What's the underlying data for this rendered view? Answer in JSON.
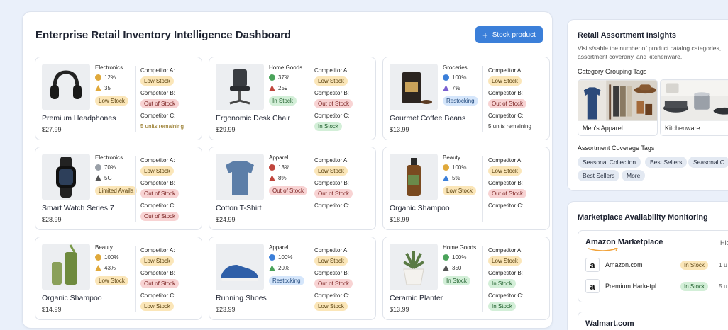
{
  "dashboard": {
    "title": "Enterprise Retail Inventory Intelligence Dashboard",
    "stock_button": "Stock product"
  },
  "products": [
    {
      "category": "Electronics",
      "stat1": "12%",
      "stat2": "35",
      "own_status": "Low Stock",
      "name": "Premium Headphones",
      "price": "$27.99",
      "comp_a": "Low Stock",
      "comp_b": "Out of Stock",
      "comp_c": "5 units remaining"
    },
    {
      "category": "Home Goods",
      "stat1": "37%",
      "stat2": "259",
      "own_status": "In Stock",
      "name": "Ergonomic Desk Chair",
      "price": "$29.99",
      "comp_a": "Low Stock",
      "comp_b": "Out of Stock",
      "comp_c": "In Stock"
    },
    {
      "category": "Groceries",
      "stat1": "100%",
      "stat2": "7%",
      "own_status": "Restocking",
      "name": "Gourmet Coffee Beans",
      "price": "$13.99",
      "comp_a": "Low Stock",
      "comp_b": "Out of Stock",
      "comp_c": "5 units remaining"
    },
    {
      "category": "Electronics",
      "stat1": "70%",
      "stat2": "5G",
      "own_status": "Limited Availa",
      "name": "Smart Watch Series 7",
      "price": "$28.99",
      "comp_a": "Low Stock",
      "comp_b": "Out of Stock",
      "comp_c": "Out of Stock"
    },
    {
      "category": "Apparel",
      "stat1": "13%",
      "stat2": "8%",
      "own_status": "Out of Stock",
      "name": "Cotton T-Shirt",
      "price": "$24.99",
      "comp_a": "Low Stock",
      "comp_b": "Out of Stock",
      "comp_c": ""
    },
    {
      "category": "Beauty",
      "stat1": "100%",
      "stat2": "5%",
      "own_status": "Low Stock",
      "name": "Organic Shampoo",
      "price": "$18.99",
      "comp_a": "Low Stock",
      "comp_b": "Out of Stock",
      "comp_c": ""
    },
    {
      "category": "Beauty",
      "stat1": "100%",
      "stat2": "43%",
      "own_status": "Low Stock",
      "name": "Organic Shampoo",
      "price": "$14.99",
      "comp_a": "Low Stock",
      "comp_b": "Out of Stock",
      "comp_c": "Low Stock"
    },
    {
      "category": "Apparel",
      "stat1": "100%",
      "stat2": "20%",
      "own_status": "Restocking",
      "name": "Running Shoes",
      "price": "$23.99",
      "comp_a": "Low Stock",
      "comp_b": "Out of Stock",
      "comp_c": "Low Stock"
    },
    {
      "category": "Home Goods",
      "stat1": "100%",
      "stat2": "350",
      "own_status": "In Stock",
      "name": "Ceramic Planter",
      "price": "$13.99",
      "comp_a": "Low Stock",
      "comp_b": "In Stock",
      "comp_c": "In Stock"
    }
  ],
  "competitor_labels": {
    "a": "Competitor A:",
    "b": "Competitor B:",
    "c": "Competitor C:"
  },
  "insights": {
    "title": "Retail Assortment Insights",
    "description": "Visits/sable the number of product catalog categories, assortment coverany, and kitchenware.",
    "grouping_title": "Category Grouping Tags",
    "groups": [
      "Men's Apparel",
      "Kitchenware"
    ],
    "coverage_title": "Assortment Coverage Tags",
    "coverage_tags": [
      "Seasonal Collection",
      "Best Sellers",
      "Seasonal C",
      "Best Sellers",
      "More"
    ]
  },
  "marketplace": {
    "title": "Marketplace Availability Monitoring",
    "amazon": {
      "name": "Amazon Marketplace",
      "hint": "Hig",
      "rows": [
        {
          "logo": "a",
          "name": "Amazon.com",
          "status": "In Stock",
          "extra": "1 u"
        },
        {
          "logo": "a",
          "name": "Premium Harketpl...",
          "status": "In Stock",
          "extra": "5 u"
        }
      ]
    },
    "walmart": {
      "name": "Walmart.com"
    }
  }
}
